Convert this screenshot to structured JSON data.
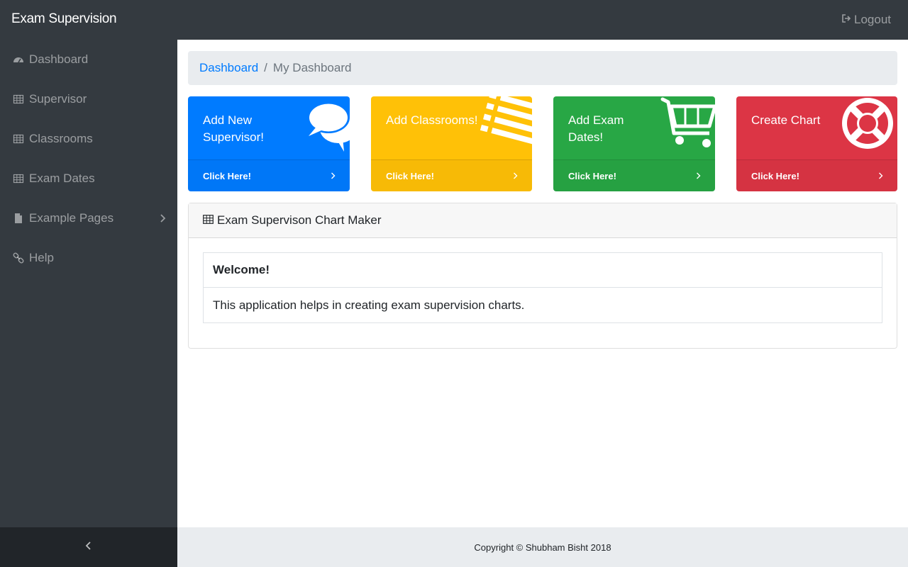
{
  "navbar": {
    "brand": "Exam Supervision",
    "logout_label": "Logout"
  },
  "sidebar": {
    "items": [
      {
        "label": "Dashboard",
        "icon": "dashboard-icon"
      },
      {
        "label": "Supervisor",
        "icon": "table-icon"
      },
      {
        "label": "Classrooms",
        "icon": "table-icon"
      },
      {
        "label": "Exam Dates",
        "icon": "table-icon"
      },
      {
        "label": "Example Pages",
        "icon": "file-icon",
        "has_submenu": true
      },
      {
        "label": "Help",
        "icon": "link-icon"
      }
    ]
  },
  "breadcrumb": {
    "link": "Dashboard",
    "current": "My Dashboard"
  },
  "cards": [
    {
      "title": "Add New Supervisor!",
      "footer": "Click Here!",
      "color": "#007bff",
      "icon": "comments-icon"
    },
    {
      "title": "Add Classrooms!",
      "footer": "Click Here!",
      "color": "#ffc107",
      "icon": "list-icon"
    },
    {
      "title": "Add Exam Dates!",
      "footer": "Click Here!",
      "color": "#28a745",
      "icon": "shopping-cart-icon"
    },
    {
      "title": "Create Chart",
      "footer": "Click Here!",
      "color": "#dc3545",
      "icon": "life-ring-icon"
    }
  ],
  "panel": {
    "header": "Exam Supervison Chart Maker",
    "table_header": "Welcome!",
    "table_body": "This application helps in creating exam supervision charts."
  },
  "footer": {
    "copyright": "Copyright © Shubham Bisht 2018"
  }
}
